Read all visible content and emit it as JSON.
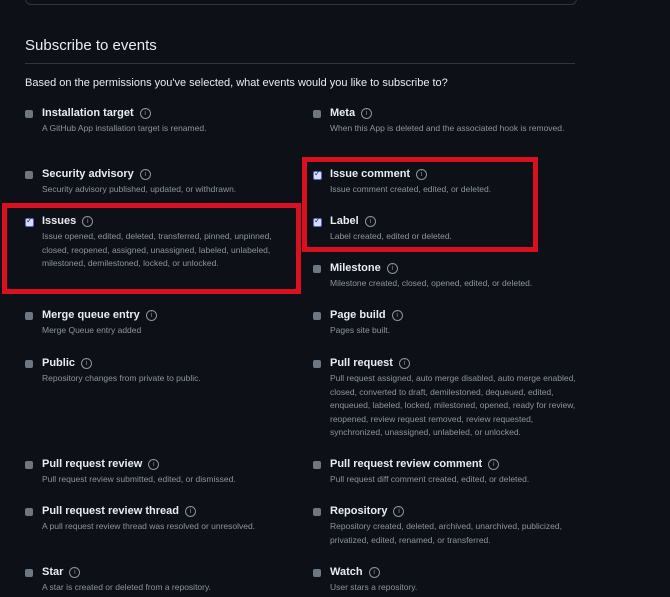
{
  "section": {
    "title": "Subscribe to events",
    "intro": "Based on the permissions you've selected, what events would you like to subscribe to?"
  },
  "info_glyph": "i",
  "events": [
    {
      "name": "Installation target",
      "desc": "A GitHub App installation target is renamed.",
      "checked": false
    },
    {
      "name": "Meta",
      "desc": "When this App is deleted and the associated hook is removed.",
      "checked": false
    },
    {
      "name": "Security advisory",
      "desc": "Security advisory published, updated, or withdrawn.",
      "checked": false
    },
    {
      "name": "Issue comment",
      "desc": "Issue comment created, edited, or deleted.",
      "checked": true
    },
    {
      "name": "Issues",
      "desc": "Issue opened, edited, deleted, transferred, pinned, unpinned, closed, reopened, assigned, unassigned, labeled, unlabeled, milestoned, demilestoned, locked, or unlocked.",
      "checked": true
    },
    {
      "name": "Label",
      "desc": "Label created, edited or deleted.",
      "checked": true
    },
    {
      "name": "Milestone",
      "desc": "Milestone created, closed, opened, edited, or deleted.",
      "checked": false
    },
    {
      "name": "Merge queue entry",
      "desc": "Merge Queue entry added",
      "checked": false
    },
    {
      "name": "Page build",
      "desc": "Pages site built.",
      "checked": false
    },
    {
      "name": "Public",
      "desc": "Repository changes from private to public.",
      "checked": false
    },
    {
      "name": "Pull request",
      "desc": "Pull request assigned, auto merge disabled, auto merge enabled, closed, converted to draft, demilestoned, dequeued, edited, enqueued, labeled, locked, milestoned, opened, ready for review, reopened, review request removed, review requested, synchronized, unassigned, unlabeled, or unlocked.",
      "checked": false
    },
    {
      "name": "Pull request review",
      "desc": "Pull request review submitted, edited, or dismissed.",
      "checked": false
    },
    {
      "name": "Pull request review comment",
      "desc": "Pull request diff comment created, edited, or deleted.",
      "checked": false
    },
    {
      "name": "Pull request review thread",
      "desc": "A pull request review thread was resolved or unresolved.",
      "checked": false
    },
    {
      "name": "Repository",
      "desc": "Repository created, deleted, archived, unarchived, publicized, privatized, edited, renamed, or transferred.",
      "checked": false
    },
    {
      "name": "Star",
      "desc": "A star is created or deleted from a repository.",
      "checked": false
    },
    {
      "name": "Watch",
      "desc": "User stars a repository.",
      "checked": false
    }
  ],
  "colors": {
    "highlight": "#d9101f",
    "background": "#0d1117"
  }
}
